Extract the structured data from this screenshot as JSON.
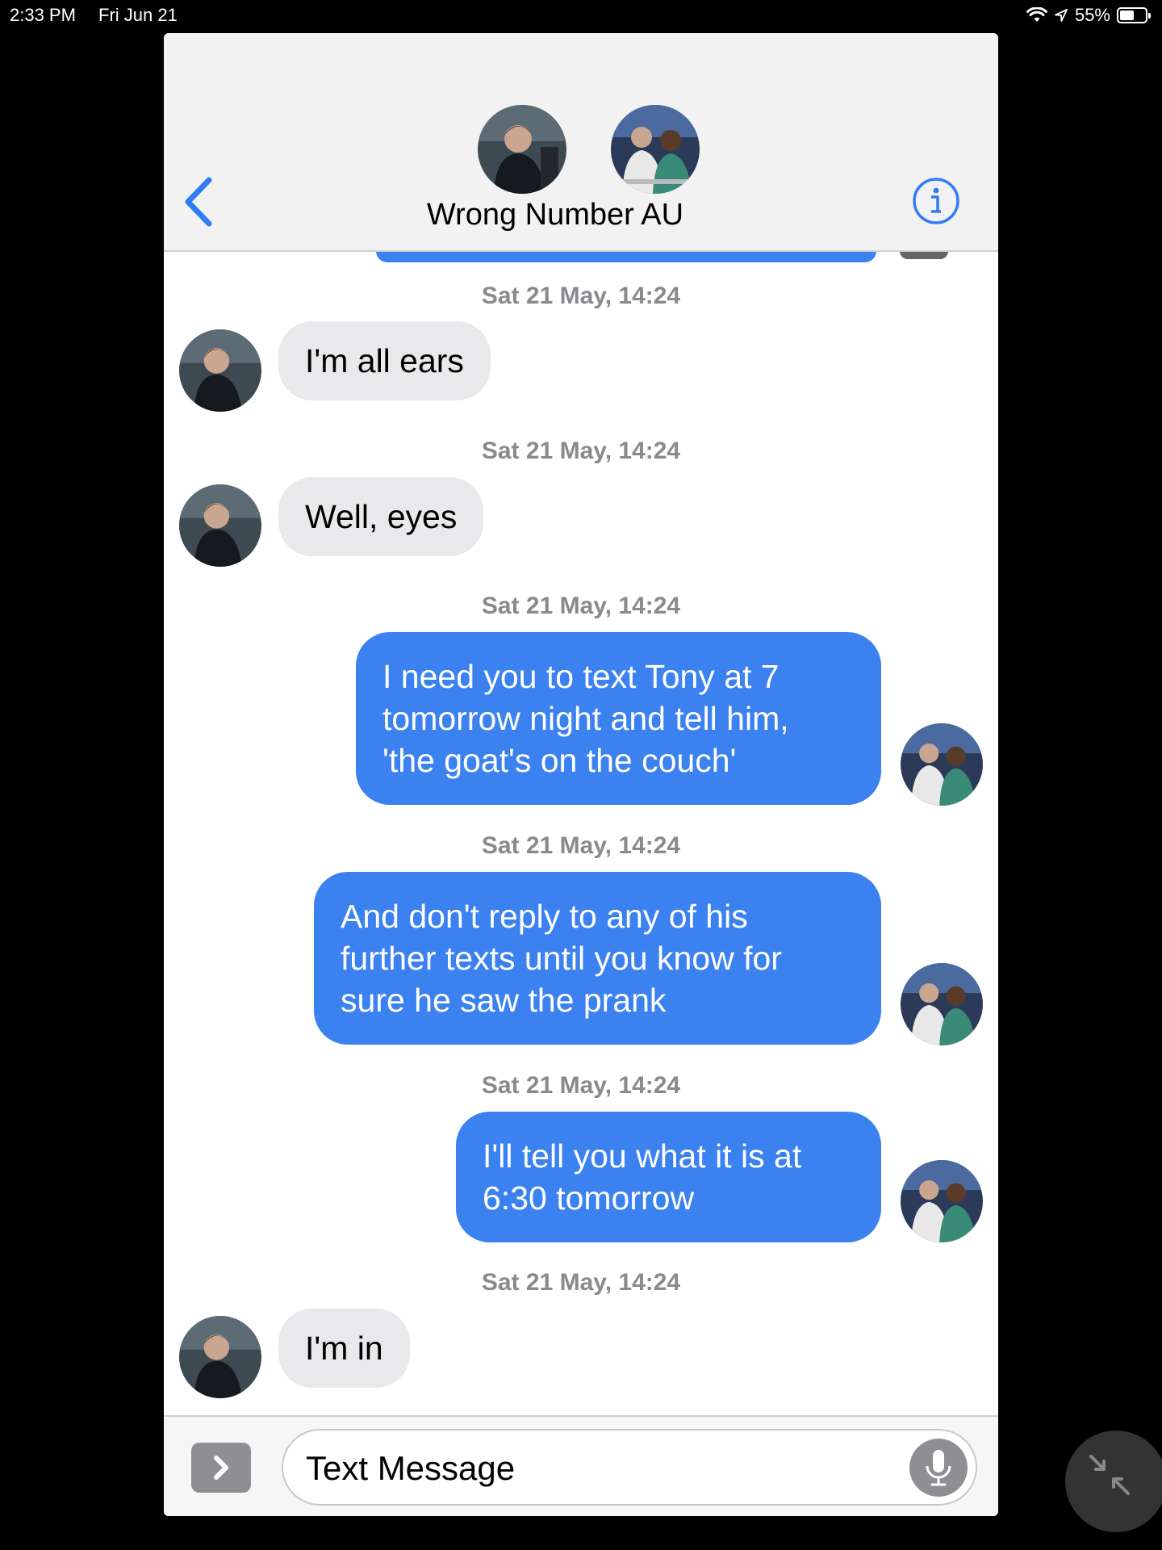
{
  "status_bar": {
    "time": "2:33 PM",
    "date": "Fri Jun 21",
    "battery": "55%",
    "battery_level": 0.55
  },
  "header": {
    "title": "Wrong Number AU"
  },
  "messages": [
    {
      "timestamp": "Sat 21 May, 14:24",
      "direction": "incoming",
      "text": "I'm all ears"
    },
    {
      "timestamp": "Sat 21 May, 14:24",
      "direction": "incoming",
      "text": "Well, eyes"
    },
    {
      "timestamp": "Sat 21 May, 14:24",
      "direction": "outgoing",
      "text": "I need you to text Tony at 7\ntomorrow night and tell him,\n'the goat's on the couch'"
    },
    {
      "timestamp": "Sat 21 May, 14:24",
      "direction": "outgoing",
      "text": "And don't reply to any of his\nfurther texts until you know for\nsure he saw the prank"
    },
    {
      "timestamp": "Sat 21 May, 14:24",
      "direction": "outgoing",
      "text": "I'll tell you what it is at\n6:30 tomorrow"
    },
    {
      "timestamp": "Sat 21 May, 14:24",
      "direction": "incoming",
      "text": "I'm in"
    }
  ],
  "composer": {
    "placeholder": "Text Message"
  },
  "icons": {
    "back": "chevron-left-icon",
    "info": "info-icon",
    "expand": "chevron-right-icon",
    "mic": "microphone-icon",
    "collapse": "collapse-icon",
    "wifi": "wifi-icon",
    "location": "location-icon"
  },
  "colors": {
    "outgoing_bubble": "#3b82f0",
    "incoming_bubble": "#e9e9eb",
    "accent": "#2f7cf6",
    "timestamp": "#8a8a8e"
  }
}
